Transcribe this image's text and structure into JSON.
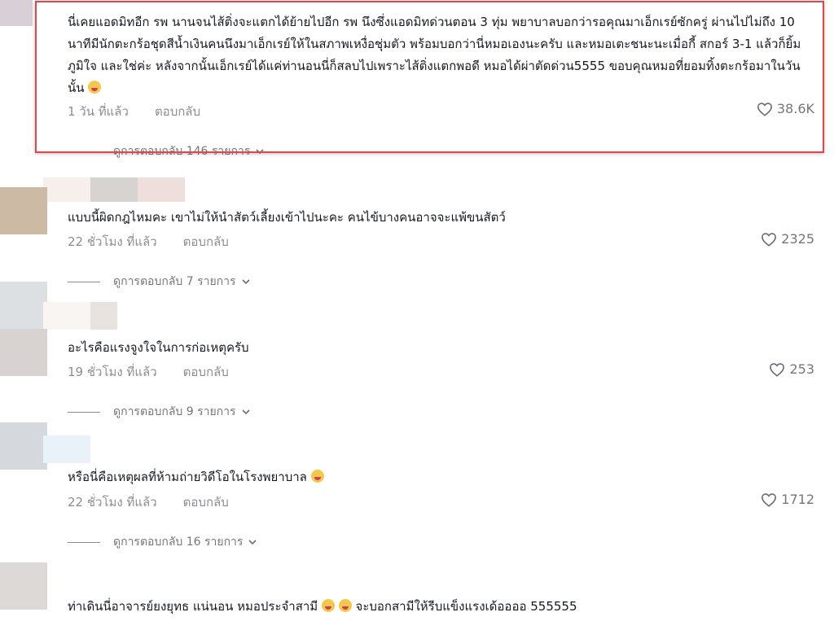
{
  "comments": [
    {
      "text": "นี่เคยแอดมิทอีก รพ นานจนไส้ติ่งจะแตกได้ย้ายไปอีก รพ นึงซึ่งแอดมิทด่วนตอน 3 ทุ่ม พยาบาลบอกว่ารอคุณมาเอ็กเรย์ซักครู่ ผ่านไปไม่ถึง 10 นาทีมีนักตะกร้อชุดสีน้ำเงินคนนึงมาเอ็กเรย์ให้ในสภาพเหงื่อชุ่มตัว พร้อมบอกว่านี่หมอเองนะครับ และหมอเตะชนะนะเมื่อกี้ สกอร์ 3-1 แล้วก็ยิ้มภูมิใจ และใช่ค่ะ หลังจากนั้นเอ็กเรย์ได้แค่ท่านอนนี่ก็สลบไปเพราะไส้ติ่งแตกพอดี หมอได้ผ่าตัดด่วน5555 ขอบคุณหมอที่ยอมทิ้งตะกร้อมาในวันนั้น",
      "time": "1 วัน ที่แล้ว",
      "reply": "ตอบกลับ",
      "likes": "38.6K",
      "view_replies": "ดูการตอบกลับ 146 รายการ"
    },
    {
      "text": "แบบนี้ผิดกฎไหมคะ เขาไม่ให้นำสัตว์เลี้ยงเข้าไปนะคะ คนไข้บางคนอาจจะแพ้ขนสัตว์",
      "time": "22 ชั่วโมง ที่แล้ว",
      "reply": "ตอบกลับ",
      "likes": "2325",
      "view_replies": "ดูการตอบกลับ 7 รายการ"
    },
    {
      "text": "อะไรคือแรงจูงใจในการก่อเหตุครับ",
      "time": "19 ชั่วโมง ที่แล้ว",
      "reply": "ตอบกลับ",
      "likes": "253",
      "view_replies": "ดูการตอบกลับ 9 รายการ"
    },
    {
      "text": "หรือนี่คือเหตุผลที่ห้ามถ่ายวิดีโอในโรงพยาบาล",
      "time": "22 ชั่วโมง ที่แล้ว",
      "reply": "ตอบกลับ",
      "likes": "1712",
      "view_replies": "ดูการตอบกลับ 16 รายการ"
    },
    {
      "text": "ท่าเดินนี่อาจารย์ยงยุทธ แน่นอน หมอประจำสามี",
      "text_tail": "จะบอกสามีให้รีบแข็งแรงเด้ออออ 555555"
    }
  ],
  "colors": {
    "highlight": "#e0464b",
    "text": "#161823"
  }
}
